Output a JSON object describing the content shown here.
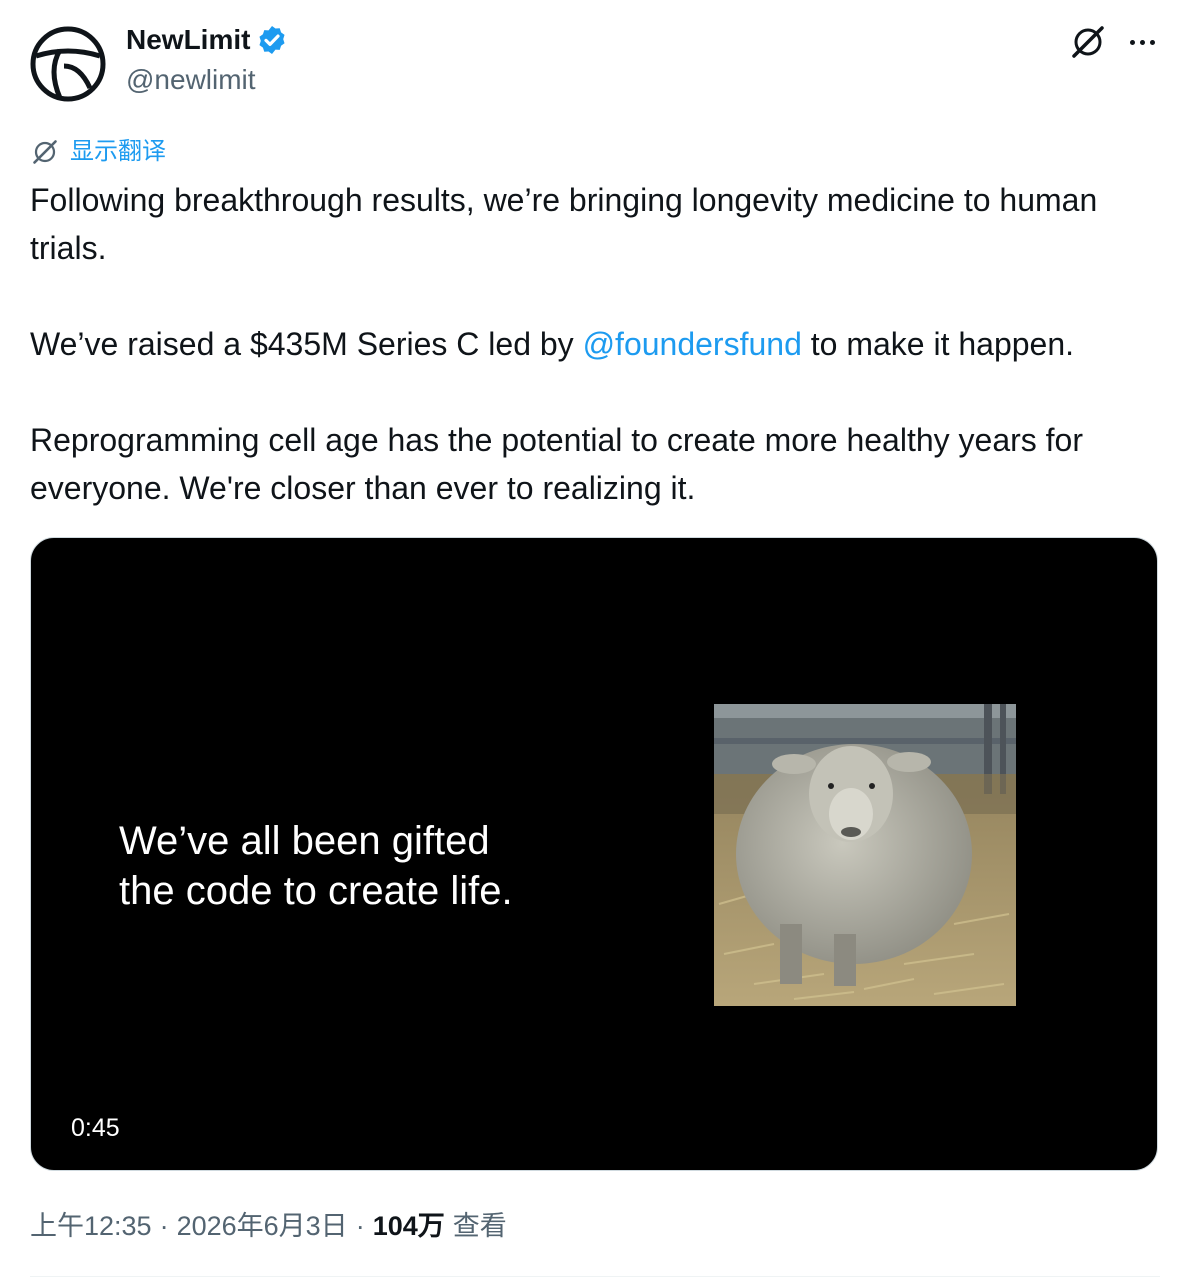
{
  "author": {
    "display_name": "NewLimit",
    "handle": "@newlimit",
    "verified_icon": "verified-badge-icon",
    "avatar_icon": "newlimit-logo-icon"
  },
  "header_actions": {
    "grok_icon": "grok-icon",
    "more_icon": "more-options-icon"
  },
  "translate": {
    "label": "显示翻译",
    "icon": "translate-icon"
  },
  "tweet": {
    "line1": "Following breakthrough results, we’re bringing longevity medicine to human trials.",
    "line2_before": "We’ve raised a $435M Series C led by ",
    "line2_mention": "@foundersfund",
    "line2_after": " to make it happen.",
    "line3": "Reprogramming cell age has the potential to create more healthy years for everyone. We're closer than ever to realizing it."
  },
  "video": {
    "caption": "We’ve all been gifted\nthe code to create life.",
    "duration": "0:45",
    "thumbnail_subject": "sheep-photo"
  },
  "meta": {
    "time": "上午12:35",
    "separator1": "·",
    "date": "2026年6月3日",
    "separator2": "·",
    "views": "104万",
    "views_label": "查看"
  },
  "colors": {
    "accent": "#1d9bf0",
    "text": "#0f1419",
    "secondary": "#536471"
  }
}
